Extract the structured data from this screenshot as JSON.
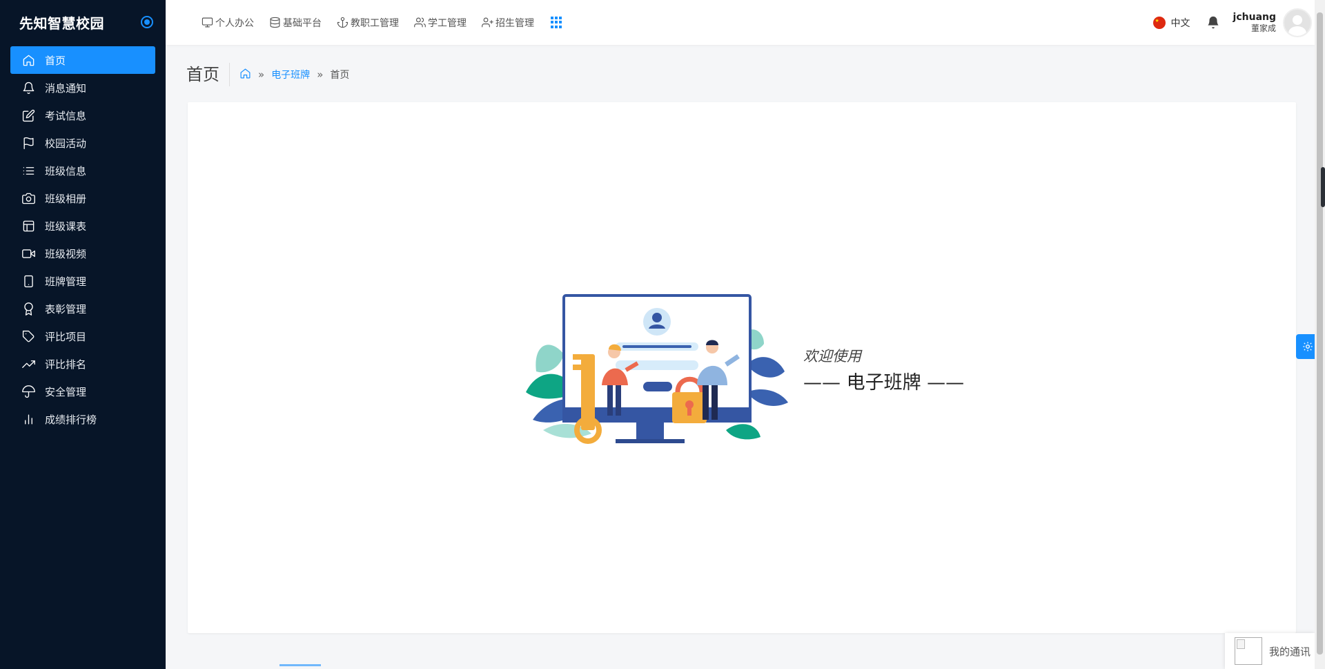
{
  "app": {
    "title": "先知智慧校园"
  },
  "sidebar": {
    "items": [
      {
        "label": "首页",
        "icon": "home-icon",
        "active": true
      },
      {
        "label": "消息通知",
        "icon": "bell-icon"
      },
      {
        "label": "考试信息",
        "icon": "edit-icon"
      },
      {
        "label": "校园活动",
        "icon": "flag-icon"
      },
      {
        "label": "班级信息",
        "icon": "list-icon"
      },
      {
        "label": "班级相册",
        "icon": "camera-icon"
      },
      {
        "label": "班级课表",
        "icon": "layout-icon"
      },
      {
        "label": "班级视频",
        "icon": "video-icon"
      },
      {
        "label": "班牌管理",
        "icon": "tablet-icon"
      },
      {
        "label": "表彰管理",
        "icon": "award-icon"
      },
      {
        "label": "评比项目",
        "icon": "tag-icon"
      },
      {
        "label": "评比排名",
        "icon": "trending-up-icon"
      },
      {
        "label": "安全管理",
        "icon": "umbrella-icon"
      },
      {
        "label": "成绩排行榜",
        "icon": "bar-chart-icon"
      }
    ]
  },
  "topnav": {
    "items": [
      {
        "label": "个人办公",
        "icon": "monitor-icon"
      },
      {
        "label": "基础平台",
        "icon": "database-icon"
      },
      {
        "label": "教职工管理",
        "icon": "anchor-icon"
      },
      {
        "label": "学工管理",
        "icon": "users-icon"
      },
      {
        "label": "招生管理",
        "icon": "user-plus-icon"
      }
    ]
  },
  "header": {
    "language": "中文",
    "user_name": "jchuang",
    "user_role": "董家成"
  },
  "page": {
    "title": "首页",
    "breadcrumb": {
      "link": "电子班牌",
      "current": "首页"
    }
  },
  "welcome": {
    "line1": "欢迎使用",
    "line2": "—— 电子班牌 ——"
  },
  "messenger": {
    "label": "我的通讯"
  },
  "colors": {
    "accent": "#1890ff",
    "sidebar_bg": "#071528"
  }
}
